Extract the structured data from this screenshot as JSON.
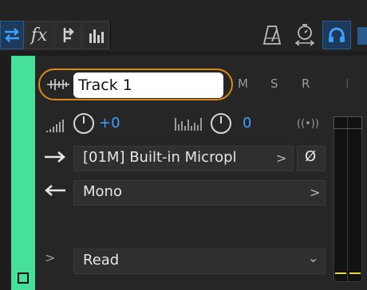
{
  "track": {
    "name": "Track 1",
    "buttons": {
      "mute": "M",
      "solo": "S",
      "record": "R",
      "input": "I"
    },
    "volume": "+0",
    "pan": "0",
    "input_source": "[01M] Built-in Micropl",
    "input_chev": ">",
    "phase_symbol": "Ø",
    "output": "Mono",
    "output_chev": ">",
    "automation": "Read",
    "automation_chev": "⌄",
    "expand_chev": ">"
  },
  "colors": {
    "track": "#46e09a",
    "accent": "#d98a18",
    "active_blue": "#3da0ff"
  },
  "icons": [
    "swap-arrows-icon",
    "fx-icon",
    "routing-icon",
    "levels-icon",
    "metronome-icon",
    "stopwatch-icon",
    "headphones-icon",
    "waveform-icon",
    "input-arrow-icon",
    "output-arrow-icon",
    "volume-icon",
    "pan-icon",
    "monitor-icon"
  ]
}
